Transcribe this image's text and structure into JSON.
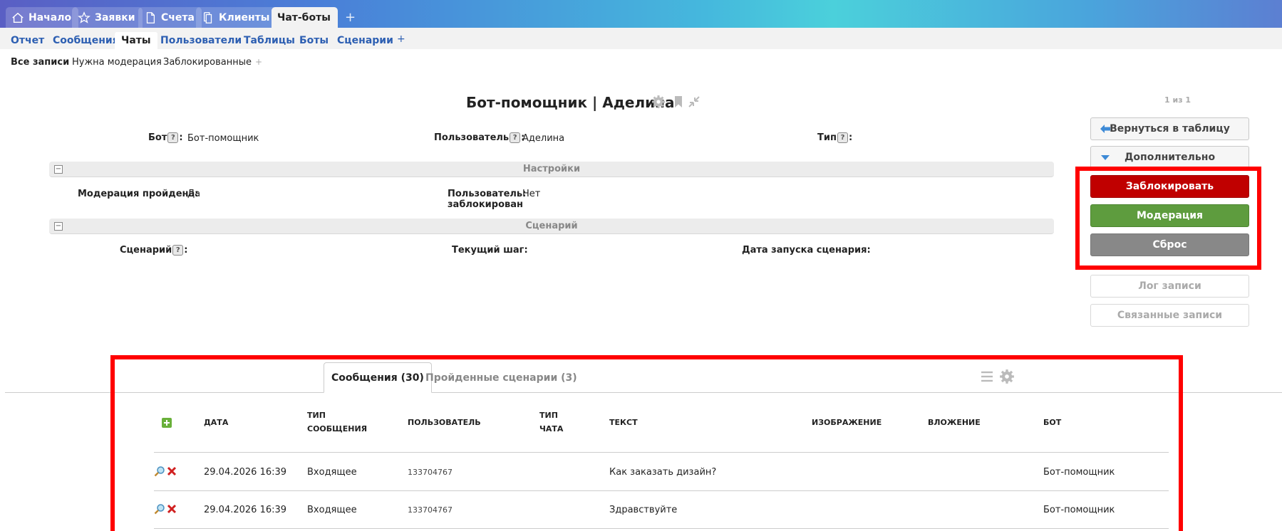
{
  "top_tabs": [
    {
      "label": "Начало",
      "icon": "home-icon"
    },
    {
      "label": "Заявки",
      "icon": "star-icon"
    },
    {
      "label": "Счета",
      "icon": "document-icon"
    },
    {
      "label": "Клиенты",
      "icon": "copy-icon"
    },
    {
      "label": "Чат-боты",
      "active": true
    }
  ],
  "top_add": "+",
  "sub_tabs": [
    "Отчет",
    "Сообщения",
    "Чаты",
    "Пользователи",
    "Таблицы",
    "Боты",
    "Сценарии"
  ],
  "sub_active": "Чаты",
  "sub_add": "+",
  "filters": [
    "Все записи",
    "Нужна модерация",
    "Заблокированные"
  ],
  "filter_add": "+",
  "record": {
    "title": "Бот-помощник | Аделина",
    "pager": "1 из 1"
  },
  "fields": {
    "bot_label": "Бот",
    "bot_value": "Бот-помощник",
    "user_label": "Пользователь",
    "user_value": "Аделина",
    "type_label": "Тип",
    "help": "?",
    "colon": ":"
  },
  "sections": {
    "settings": "Настройки",
    "scenario": "Сценарий",
    "collapse": "−"
  },
  "settings_fields": {
    "moderation_label": "Модерация пройдена:",
    "moderation_value": "Да",
    "blocked_label_1": "Пользователь:",
    "blocked_label_2": "заблокирован",
    "blocked_value": "Нет"
  },
  "scenario_fields": {
    "scenario_label": "Сценарий",
    "current_step_label": "Текущий шаг:",
    "launch_date_label": "Дата запуска сценария:"
  },
  "actions": {
    "back": "Вернуться в таблицу",
    "more": "Дополнительно",
    "block": "Заблокировать",
    "moderation": "Модерация",
    "reset": "Сброс",
    "log": "Лог записи",
    "linked": "Связанные записи"
  },
  "colors": {
    "block": "#c00000",
    "moderation": "#5e9c3e",
    "reset": "#888888",
    "highlight": "#ff0000",
    "link": "#2d5fb2"
  },
  "bottom_tabs": [
    "Сообщения (30)",
    "Пройденные сценарии (3)"
  ],
  "table": {
    "headers": {
      "date": "ДАТА",
      "msg_type_1": "ТИП",
      "msg_type_2": "СООБЩЕНИЯ",
      "user": "ПОЛЬЗОВАТЕЛЬ",
      "chat_type_1": "ТИП",
      "chat_type_2": "ЧАТА",
      "text": "ТЕКСТ",
      "image": "ИЗОБРАЖЕНИЕ",
      "attachment": "ВЛОЖЕНИЕ",
      "bot": "БОТ"
    },
    "rows": [
      {
        "date": "29.04.2026 16:39",
        "type": "Входящее",
        "user": "133704767",
        "text": "Как заказать дизайн?",
        "bot": "Бот-помощник"
      },
      {
        "date": "29.04.2026 16:39",
        "type": "Входящее",
        "user": "133704767",
        "text": "Здравствуйте",
        "bot": "Бот-помощник"
      }
    ]
  }
}
